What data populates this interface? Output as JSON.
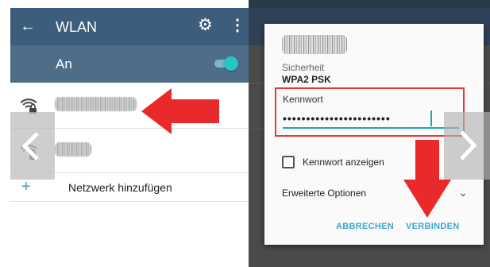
{
  "wifi_settings": {
    "title": "WLAN",
    "back_icon": "arrow-left-icon",
    "settings_icon": "gear-icon",
    "more_icon": "more-vert-icon",
    "master_switch_label": "An",
    "master_switch_on": true,
    "accent_color": "#28c2c9",
    "networks": [
      {
        "icon": "wifi-lock-icon"
      },
      {
        "icon": "wifi-lock-icon"
      }
    ],
    "add_network_label": "Netzwerk hinzufügen",
    "add_icon": "plus-icon"
  },
  "dialog": {
    "security_label": "Sicherheit",
    "security_value": "WPA2 PSK",
    "password_label": "Kennwort",
    "password_value": "•••••••••••••••••••••••",
    "show_password_label": "Kennwort anzeigen",
    "show_password_checked": false,
    "advanced_label": "Erweiterte Optionen",
    "cancel_label": "ABBRECHEN",
    "connect_label": "VERBINDEN",
    "highlight_color": "#e53935",
    "button_color": "#3aa6d0"
  },
  "carousel": {
    "prev_icon": "chevron-left-icon",
    "next_icon": "chevron-right-icon"
  }
}
